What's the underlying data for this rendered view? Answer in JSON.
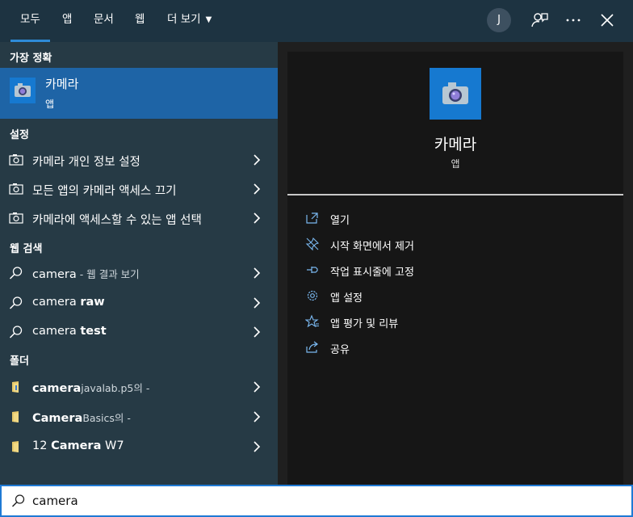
{
  "tabs": [
    {
      "label": "모두"
    },
    {
      "label": "앱"
    },
    {
      "label": "문서"
    },
    {
      "label": "웹"
    },
    {
      "label": "더 보기"
    }
  ],
  "user": {
    "initial": "J"
  },
  "best_match": {
    "heading": "가장 정확",
    "title": "카메라",
    "subtitle": "앱"
  },
  "settings": {
    "heading": "설정",
    "items": [
      {
        "label": "카메라 개인 정보 설정"
      },
      {
        "label": "모든 앱의 카메라 액세스 끄기"
      },
      {
        "label": "카메라에 액세스할 수 있는 앱 선택"
      }
    ]
  },
  "web": {
    "heading": "웹 검색",
    "items": [
      {
        "query": "camera",
        "suffix": " - 웹 결과 보기"
      },
      {
        "query": "camera",
        "bold": "raw"
      },
      {
        "query": "camera",
        "bold": "test"
      }
    ]
  },
  "folders": {
    "heading": "폴더",
    "items": [
      {
        "bold": "camera",
        "rest": "javalab.p5의 -"
      },
      {
        "bold": "Camera",
        "rest": "Basics의 -"
      },
      {
        "prefix": "12 ",
        "bold": "Camera",
        "suffix": " W7"
      }
    ]
  },
  "preview": {
    "title": "카메라",
    "subtitle": "앱",
    "actions": [
      {
        "label": "열기",
        "icon": "open-icon"
      },
      {
        "label": "시작 화면에서 제거",
        "icon": "unpin-icon"
      },
      {
        "label": "작업 표시줄에 고정",
        "icon": "pin-icon"
      },
      {
        "label": "앱 설정",
        "icon": "gear-icon"
      },
      {
        "label": "앱 평가 및 리뷰",
        "icon": "star-icon"
      },
      {
        "label": "공유",
        "icon": "share-icon"
      }
    ]
  },
  "search": {
    "value": "camera"
  },
  "colors": {
    "accent": "#1f7ad4",
    "selected": "#1e64a6",
    "panel": "#263a45"
  }
}
